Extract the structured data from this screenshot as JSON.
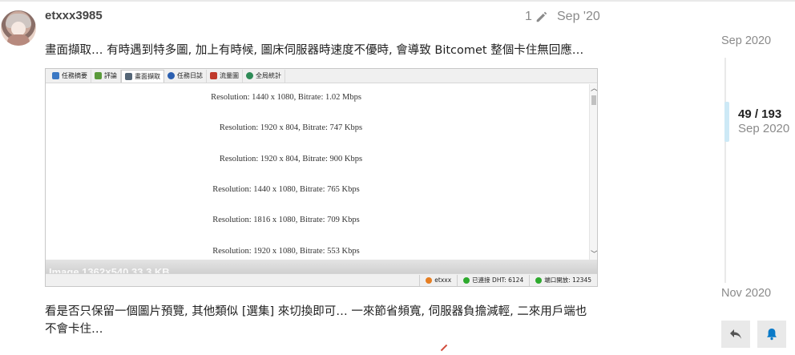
{
  "post": {
    "username": "etxxx3985",
    "edit_count": "1",
    "date": "Sep '20",
    "paragraph1": "畫面擷取… 有時遇到特多圖, 加上有時候, 圖床伺服器時速度不優時, 會導致 Bitcomet 整個卡住無回應…",
    "paragraph2": "看是否只保留一個圖片預覽, 其他類似 [選集] 來切換即可… 一來節省頻寬, 伺服器負擔減輕, 二來用戶端也不會卡住…"
  },
  "screenshot": {
    "tabs": [
      {
        "label": "任務摘要",
        "icon": "summary-icon",
        "color": "#3b78c4"
      },
      {
        "label": "評論",
        "icon": "comment-icon",
        "color": "#5a9a3a"
      },
      {
        "label": "畫面擷取",
        "icon": "capture-icon",
        "color": "#556677"
      },
      {
        "label": "任務日誌",
        "icon": "info-icon",
        "color": "#2b5fb0"
      },
      {
        "label": "流量圖",
        "icon": "graph-icon",
        "color": "#c0392b"
      },
      {
        "label": "全局統計",
        "icon": "globe-icon",
        "color": "#2e8b57"
      }
    ],
    "active_tab": 2,
    "resolutions": [
      "Resolution: 1440 x 1080, Bitrate: 1.02 Mbps",
      "Resolution: 1920 x 804, Bitrate: 747 Kbps",
      "Resolution: 1920 x 804, Bitrate: 900 Kbps",
      "Resolution: 1440 x 1080, Bitrate: 765 Kbps",
      "Resolution: 1816 x 1080, Bitrate: 709 Kbps",
      "Resolution: 1920 x 1080, Bitrate: 553 Kbps"
    ],
    "watermark": "Image 1362×540 33.3 KB",
    "status": [
      {
        "label": "etxxx",
        "color": "#e67e22"
      },
      {
        "label": "已連接 DHT: 6124",
        "color": "#2eaa2e"
      },
      {
        "label": "端口開放: 12345",
        "color": "#2eaa2e"
      }
    ]
  },
  "timeline": {
    "top_date": "Sep 2020",
    "position": "49 / 193",
    "current_date": "Sep 2020",
    "bottom_date": "Nov 2020"
  },
  "colors": {
    "accent_handle": "#cde9f6",
    "muted_text": "#8a8a8a"
  }
}
